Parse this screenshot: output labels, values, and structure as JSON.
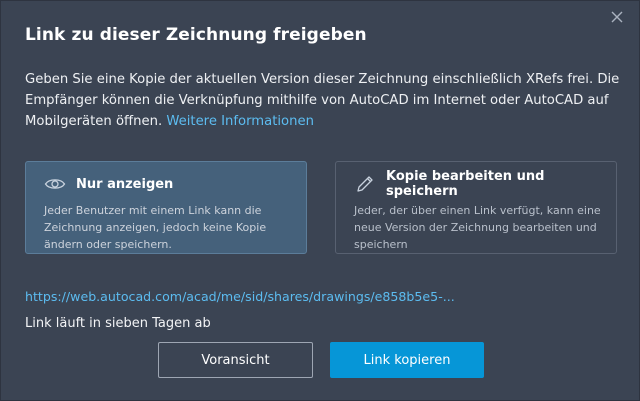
{
  "dialog": {
    "title": "Link zu dieser Zeichnung freigeben",
    "description_text": "Geben Sie eine Kopie der aktuellen Version dieser Zeichnung einschließlich XRefs frei. Die Empfänger können die Verknüpfung mithilfe von AutoCAD im Internet oder AutoCAD auf Mobilgeräten öffnen.",
    "more_link": "Weitere Informationen",
    "close_icon": "close-icon"
  },
  "options": [
    {
      "title": "Nur anzeigen",
      "description": "Jeder Benutzer mit einem Link kann die Zeichnung anzeigen, jedoch keine Kopie ändern oder speichern.",
      "icon": "eye-icon",
      "selected": true
    },
    {
      "title": "Kopie bearbeiten und speichern",
      "description": "Jeder, der über einen Link verfügt, kann eine neue Version der Zeichnung bearbeiten und speichern",
      "icon": "pencil-icon",
      "selected": false
    }
  ],
  "share": {
    "url": "https://web.autocad.com/acad/me/sid/shares/drawings/e858b5e5-...",
    "expiry": "Link läuft in sieben Tagen ab"
  },
  "buttons": {
    "preview": "Voransicht",
    "copy": "Link kopieren"
  },
  "colors": {
    "background": "#3b4453",
    "accent": "#0696d7",
    "link": "#5cbcf0",
    "selected_card": "#45617b"
  }
}
